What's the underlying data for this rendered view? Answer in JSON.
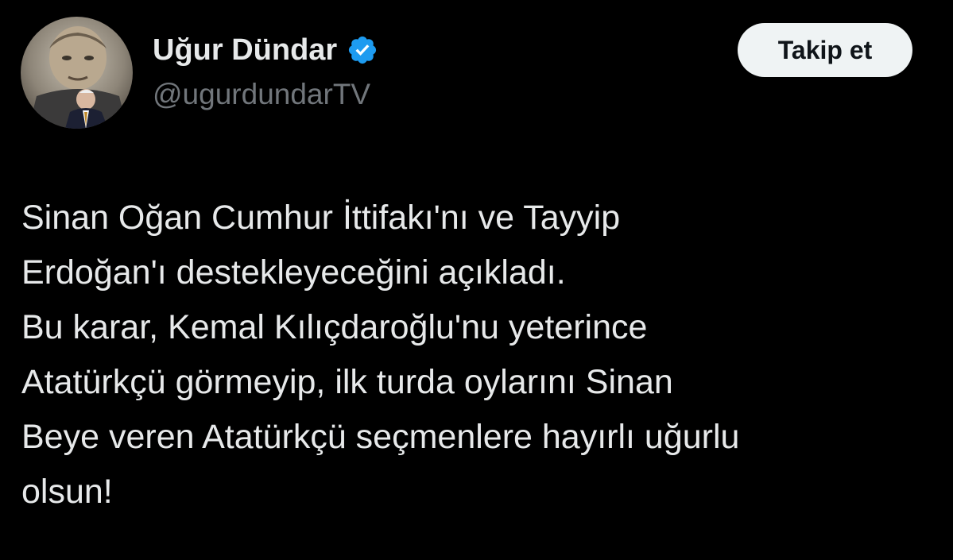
{
  "author": {
    "display_name": "Uğur Dündar",
    "handle": "@ugurdundarTV",
    "verified": true,
    "avatar_icon": "portrait-avatar-icon",
    "verified_icon": "verified-badge-icon"
  },
  "follow_button": {
    "label": "Takip et"
  },
  "tweet": {
    "lines": [
      "Sinan Oğan Cumhur İttifakı'nı ve Tayyip",
      "Erdoğan'ı destekleyeceğini açıkladı.",
      "Bu karar, Kemal Kılıçdaroğlu'nu yeterince",
      "Atatürkçü görmeyip, ilk turda oylarını Sinan",
      "Beye veren Atatürkçü seçmenlere hayırlı uğurlu",
      "olsun!"
    ]
  },
  "colors": {
    "background": "#000000",
    "text_primary": "#e7e9ea",
    "text_secondary": "#71767b",
    "verified_blue": "#1d9bf0",
    "button_bg": "#eff3f4",
    "button_text": "#0f1419"
  }
}
